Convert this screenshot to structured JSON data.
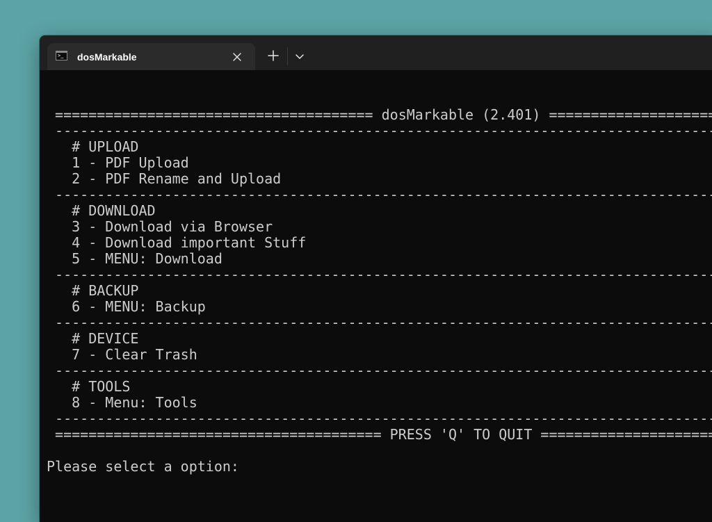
{
  "tab": {
    "title": "dosMarkable",
    "icon_glyph": ">_"
  },
  "terminal": {
    "lines": [
      "",
      " ====================================== dosMarkable (2.401) ==================================",
      " -----------------------------------------------------------------------------------------------",
      "   # UPLOAD",
      "   1 - PDF Upload",
      "   2 - PDF Rename and Upload",
      " -----------------------------------------------------------------------------------------------",
      "   # DOWNLOAD",
      "   3 - Download via Browser",
      "   4 - Download important Stuff",
      "   5 - MENU: Download",
      " -----------------------------------------------------------------------------------------------",
      "   # BACKUP",
      "   6 - MENU: Backup",
      " -----------------------------------------------------------------------------------------------",
      "   # DEVICE",
      "   7 - Clear Trash",
      " -----------------------------------------------------------------------------------------------",
      "   # TOOLS",
      "   8 - Menu: Tools",
      " -----------------------------------------------------------------------------------------------",
      " ======================================= PRESS 'Q' TO QUIT =====================================",
      "",
      "Please select a option: "
    ]
  },
  "colors": {
    "desktop": "#5ca3a5",
    "titlebar": "#202020",
    "tab": "#2b2b2b",
    "terminal_bg": "#0c0c0c",
    "terminal_text": "#cccccc"
  }
}
